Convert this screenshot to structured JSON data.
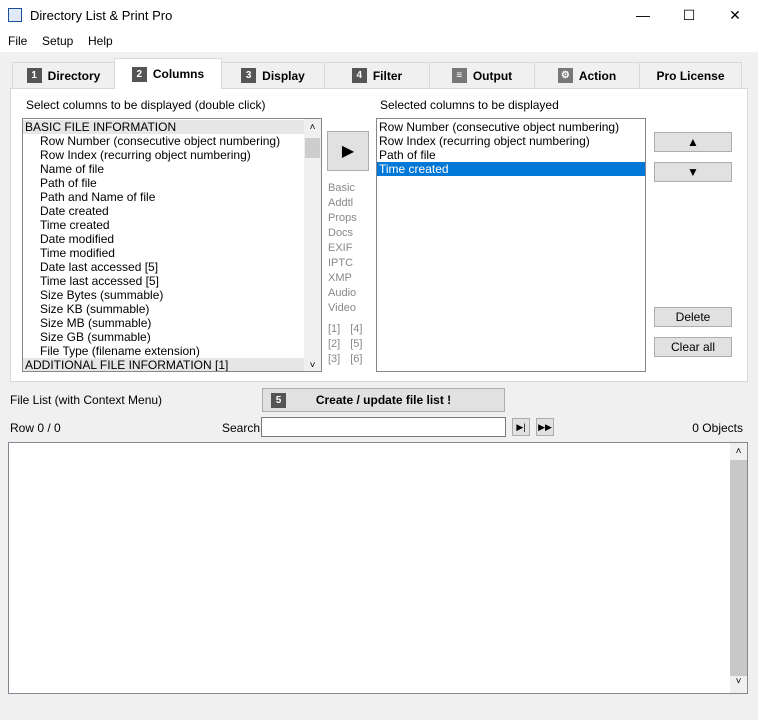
{
  "window": {
    "title": "Directory List & Print Pro",
    "minimize": "—",
    "maximize": "☐",
    "close": "✕"
  },
  "menu": [
    "File",
    "Setup",
    "Help"
  ],
  "tabs": [
    {
      "num": "1",
      "label": "Directory"
    },
    {
      "num": "2",
      "label": "Columns"
    },
    {
      "num": "3",
      "label": "Display"
    },
    {
      "num": "4",
      "label": "Filter"
    },
    {
      "num": "",
      "label": "Output"
    },
    {
      "num": "",
      "label": "Action"
    },
    {
      "num": "",
      "label": "Pro License"
    }
  ],
  "columns": {
    "available_label": "Select columns to be displayed (double click)",
    "selected_label": "Selected columns to be displayed",
    "available": [
      {
        "text": "BASIC FILE INFORMATION",
        "type": "header"
      },
      {
        "text": "Row Number  (consecutive object numbering)"
      },
      {
        "text": "Row Index  (recurring object numbering)"
      },
      {
        "text": "Name of file"
      },
      {
        "text": "Path of file"
      },
      {
        "text": "Path and Name of file"
      },
      {
        "text": "Date created"
      },
      {
        "text": "Time created"
      },
      {
        "text": "Date modified"
      },
      {
        "text": "Time modified"
      },
      {
        "text": "Date last accessed [5]"
      },
      {
        "text": "Time last accessed [5]"
      },
      {
        "text": "Size Bytes  (summable)"
      },
      {
        "text": "Size KB  (summable)"
      },
      {
        "text": "Size MB  (summable)"
      },
      {
        "text": "Size GB  (summable)"
      },
      {
        "text": "File Type  (filename extension)"
      },
      {
        "text": "ADDITIONAL FILE INFORMATION [1]",
        "type": "header"
      }
    ],
    "selected": [
      "Row Number  (consecutive object numbering)",
      "Row Index  (recurring object numbering)",
      "Path of file",
      "Time created"
    ],
    "selected_index": 3,
    "add_button": "▶",
    "groups": [
      "Basic",
      "Addtl",
      "Props",
      "Docs",
      "EXIF",
      "IPTC",
      "XMP",
      "Audio",
      "Video"
    ],
    "notes": [
      [
        "[1]",
        "[4]"
      ],
      [
        "[2]",
        "[5]"
      ],
      [
        "[3]",
        "[6]"
      ]
    ],
    "up_button": "▲",
    "down_button": "▼",
    "delete_button": "Delete",
    "clear_button": "Clear all"
  },
  "filelist": {
    "label": "File List (with Context Menu)",
    "create_num": "5",
    "create_button": "Create / update file list !",
    "row": "Row 0 / 0",
    "search_label": "Search",
    "search_value": "",
    "objects": "0 Objects",
    "find_next": "▶|",
    "find_all": "▶▶"
  },
  "colors": {
    "selection": "#0078d7",
    "accent": "#555555"
  }
}
